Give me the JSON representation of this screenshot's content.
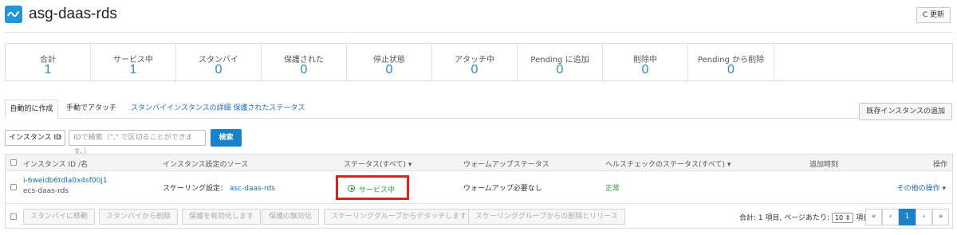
{
  "header": {
    "title": "asg-daas-rds",
    "refresh_label": "C 更新"
  },
  "stats": [
    {
      "label": "合計",
      "value": "1"
    },
    {
      "label": "サービス中",
      "value": "1"
    },
    {
      "label": "スタンバイ",
      "value": "0"
    },
    {
      "label": "保護された",
      "value": "0"
    },
    {
      "label": "停止状態",
      "value": "0"
    },
    {
      "label": "アタッチ中",
      "value": "0"
    },
    {
      "label": "Pending に追加",
      "value": "0"
    },
    {
      "label": "削除中",
      "value": "0"
    },
    {
      "label": "Pending から削除",
      "value": "0"
    }
  ],
  "tabs": {
    "auto": "自動的に作成",
    "manual": "手動でアタッチ",
    "link": "スタンバイインスタンスの詳細 保護されたステータス"
  },
  "add_button": "既存インスタンスの追加",
  "filter": {
    "select": "インスタンス ID",
    "placeholder": "IDで検索（\",\" で区切ることができます。）",
    "search_button": "検索"
  },
  "table": {
    "headers": {
      "id": "インスタンス ID /名",
      "source": "インスタンス設定のソース",
      "status": "ステータス(すべて)",
      "warmup": "ウォームアップステータス",
      "health": "ヘルスチェックのステータス(すべて)",
      "added": "追加時刻",
      "ops": "操作"
    },
    "row": {
      "id": "i-6weidb6tdla0x4sf00j1",
      "name": "ecs-daas-rds",
      "source_prefix": "スケーリング設定：",
      "source_link": "asc-daas-rds",
      "status": "サービス中",
      "warmup": "ウォームアップ必要なし",
      "health": "正常",
      "ops": "その他の操作"
    }
  },
  "footer": {
    "buttons": [
      "スタンバイに移動",
      "スタンバイから削除",
      "保護を有効化します",
      "保護の無効化",
      "スケーリンググループからデタッチします",
      "スケーリンググループからの削除とリリース"
    ],
    "summary_prefix": "合計: 1 項目, ページあたり:",
    "per_page": "10",
    "summary_suffix": "項目",
    "pager": [
      "«",
      "‹",
      "1",
      "›",
      "»"
    ]
  }
}
